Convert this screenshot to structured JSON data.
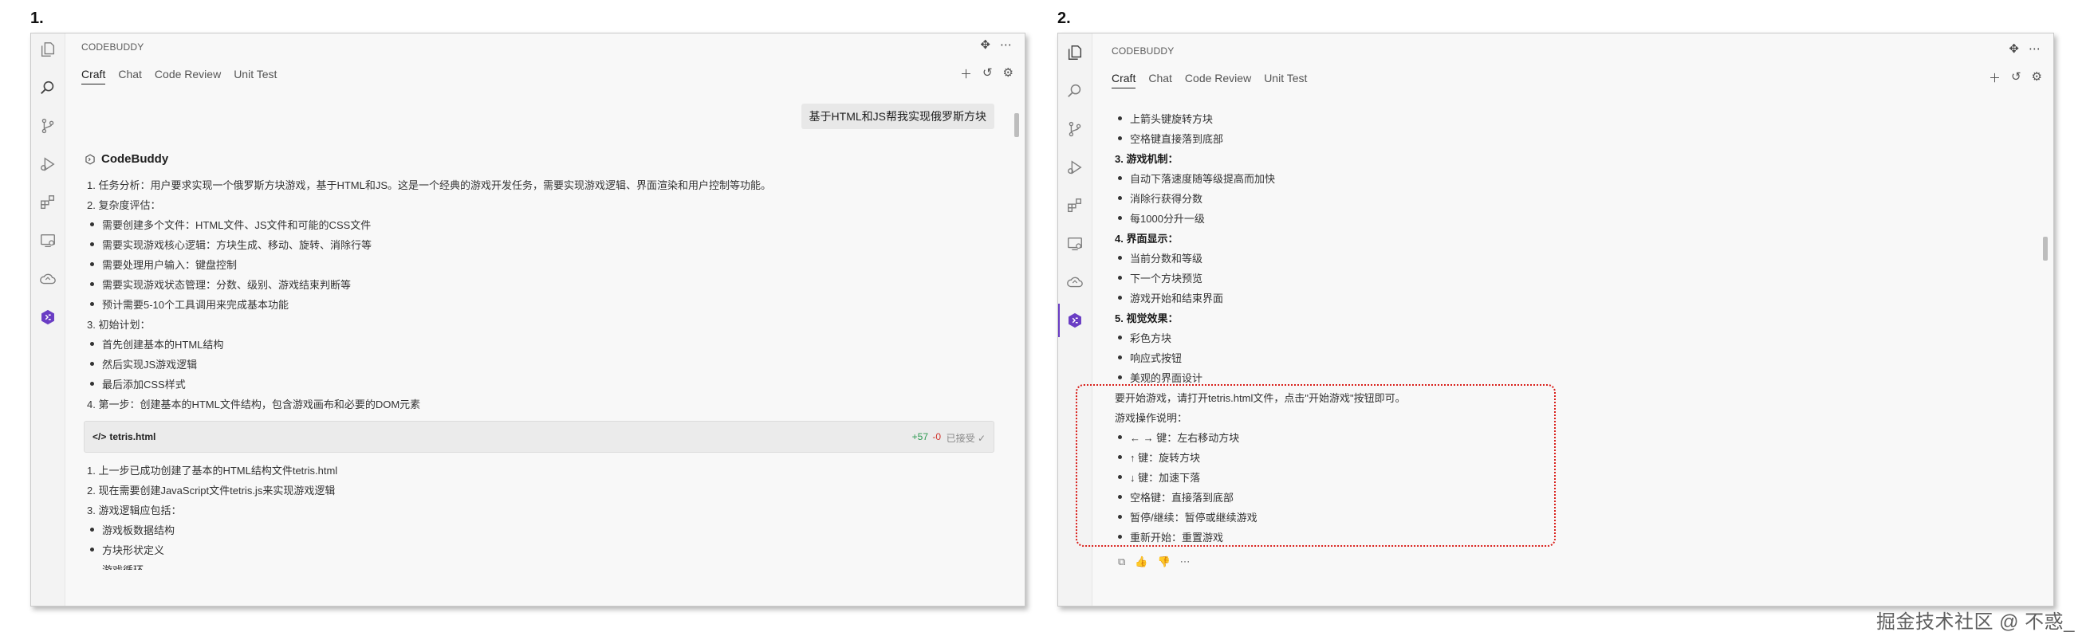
{
  "labels": {
    "first": "1.",
    "second": "2."
  },
  "brand_header": "CODEBUDDY",
  "tabs": [
    "Craft",
    "Chat",
    "Code Review",
    "Unit Test"
  ],
  "icons": {
    "activity_bar": [
      "explorer-icon",
      "search-icon",
      "source-control-icon",
      "run-debug-icon",
      "extensions-icon",
      "remote-explorer-icon",
      "cloud-icon",
      "codebuddy-icon"
    ],
    "header": [
      "move-icon",
      "more-icon"
    ],
    "toolbar": [
      "plus-icon",
      "history-icon",
      "settings-icon"
    ]
  },
  "colors": {
    "accent": "#6a3dc4",
    "highlight": "#d9201b",
    "added": "#2e9a52",
    "removed": "#d0342c"
  },
  "panel1": {
    "user_message": "基于HTML和JS帮我实现俄罗斯方块",
    "brand_name": "CodeBuddy",
    "lines": [
      "1. 任务分析：用户要求实现一个俄罗斯方块游戏，基于HTML和JS。这是一个经典的游戏开发任务，需要实现游戏逻辑、界面渲染和用户控制等功能。",
      "2. 复杂度评估：",
      "需要创建多个文件：HTML文件、JS文件和可能的CSS文件",
      "需要实现游戏核心逻辑：方块生成、移动、旋转、消除行等",
      "需要处理用户输入：键盘控制",
      "需要实现游戏状态管理：分数、级别、游戏结束判断等",
      "预计需要5-10个工具调用来完成基本功能",
      "3. 初始计划：",
      "首先创建基本的HTML结构",
      "然后实现JS游戏逻辑",
      "最后添加CSS样式",
      "4. 第一步：创建基本的HTML文件结构，包含游戏画布和必要的DOM元素"
    ],
    "file_card": {
      "name": "tetris.html",
      "added": "+57",
      "removed": "-0",
      "status": "已接受"
    },
    "after_lines": [
      "1. 上一步已成功创建了基本的HTML结构文件tetris.html",
      "2. 现在需要创建JavaScript文件tetris.js来实现游戏逻辑",
      "3. 游戏逻辑应包括：",
      "游戏板数据结构",
      "方块形状定义",
      "游戏循环"
    ]
  },
  "panel2": {
    "lines": [
      "上箭头键旋转方块",
      "空格键直接落到底部",
      "3. 游戏机制：",
      "自动下落速度随等级提高而加快",
      "消除行获得分数",
      "每1000分升一级",
      "4. 界面显示：",
      "当前分数和等级",
      "下一个方块预览",
      "游戏开始和结束界面",
      "5. 视觉效果：",
      "彩色方块",
      "响应式按钮",
      "美观的界面设计"
    ],
    "highlight_lines": [
      "要开始游戏，请打开tetris.html文件，点击\"开始游戏\"按钮即可。",
      "游戏操作说明：",
      "← → 键：左右移动方块",
      "↑ 键：旋转方块",
      "↓ 键：加速下落",
      "空格键：直接落到底部",
      "暂停/继续：暂停或继续游戏",
      "重新开始：重置游戏"
    ],
    "feedback_icons": [
      "copy-icon",
      "thumbs-up-icon",
      "thumbs-down-icon",
      "more-icon"
    ]
  },
  "watermark": "掘金技术社区 @ 不惑_"
}
